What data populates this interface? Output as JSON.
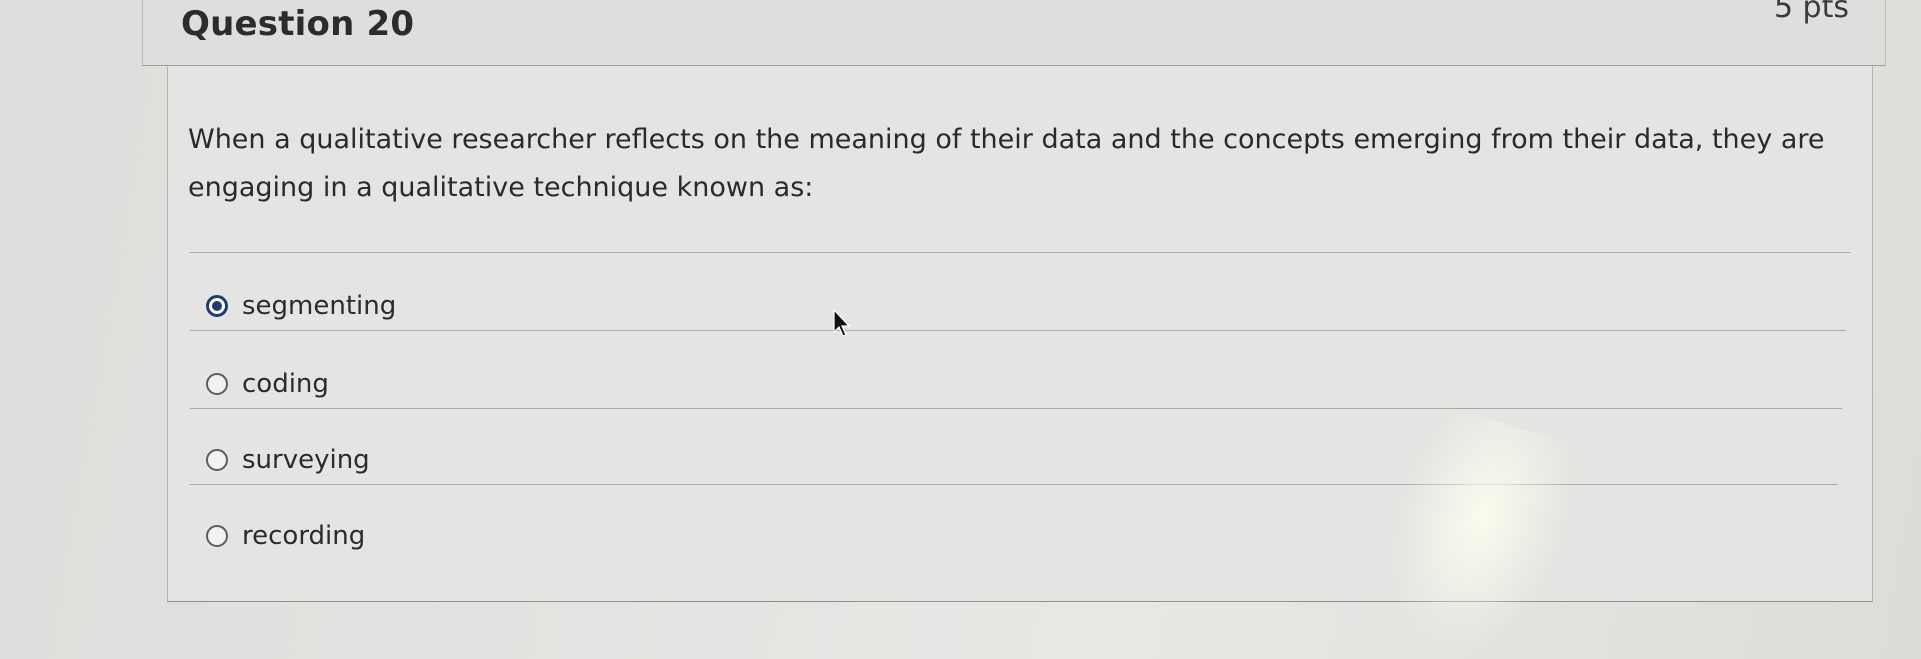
{
  "question": {
    "title": "Question 20",
    "points": "5 pts",
    "text": "When a qualitative researcher reflects on the meaning of their data and the concepts emerging from their data, they are engaging in a qualitative technique known as:"
  },
  "answers": [
    {
      "label": "segmenting",
      "selected": true
    },
    {
      "label": "coding",
      "selected": false
    },
    {
      "label": "surveying",
      "selected": false
    },
    {
      "label": "recording",
      "selected": false
    }
  ],
  "colors": {
    "selected_radio": "#1b3d73",
    "text": "#2b2b2b"
  }
}
